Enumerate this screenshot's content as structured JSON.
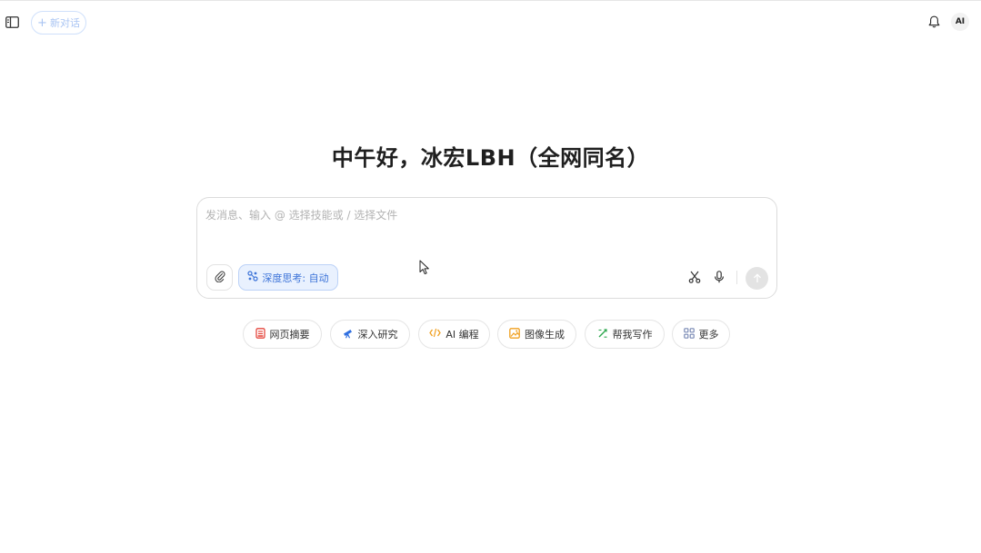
{
  "header": {
    "new_chat_label": "新对话",
    "new_chat_icon": "plus-icon",
    "sidebar_icon": "sidebar-toggle-icon",
    "bell_icon": "bell-icon",
    "avatar_initials": "AI"
  },
  "greeting": "中午好，冰宏LBH（全网同名）",
  "composer": {
    "placeholder": "发消息、输入 @ 选择技能或 / 选择文件",
    "value": "",
    "deep_thinking_label": "深度思考: 自动",
    "attach_icon": "paperclip-icon",
    "deep_thinking_icon": "deep-thinking-icon",
    "scissors_icon": "scissors-icon",
    "mic_icon": "microphone-icon",
    "send_icon": "arrow-up-icon"
  },
  "quick_actions": [
    {
      "label": "网页摘要",
      "icon": "web-summary-icon",
      "color": "#e5483f"
    },
    {
      "label": "深入研究",
      "icon": "telescope-icon",
      "color": "#2f6fe0"
    },
    {
      "label": "AI 编程",
      "icon": "code-icon",
      "color": "#f0a020"
    },
    {
      "label": "图像生成",
      "icon": "image-icon",
      "color": "#f0a020"
    },
    {
      "label": "帮我写作",
      "icon": "pen-icon",
      "color": "#2fa84f"
    },
    {
      "label": "更多",
      "icon": "grid-icon",
      "color": "#7b8bb5"
    }
  ],
  "colors": {
    "accent": "#3c73d8",
    "accent_bg": "#e9f1fe"
  }
}
